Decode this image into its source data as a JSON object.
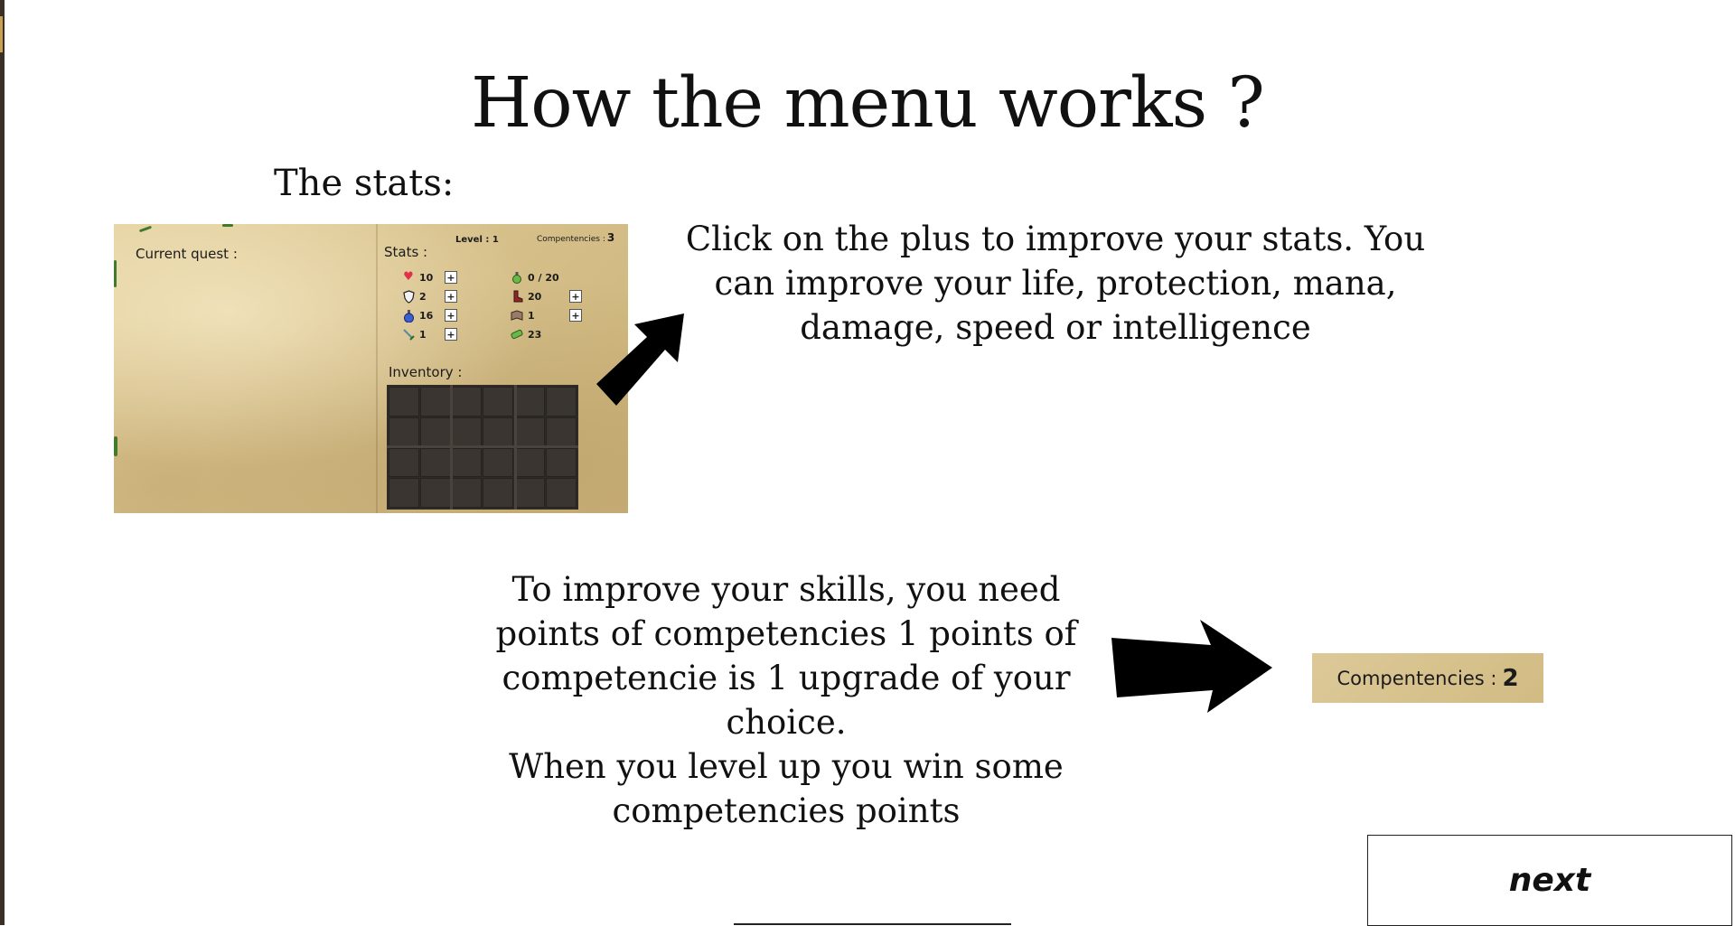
{
  "page": {
    "title": "How the menu works ?",
    "stats_heading": "The stats:",
    "description_stats": "Click on the plus to improve your stats. You can improve your life, protection, mana, damage, speed or intelligence",
    "description_competencies_1": "To improve your skills, you need points of competencies 1 points of competencie is 1 upgrade of your choice.",
    "description_competencies_2": "When you level up you win some competencies points",
    "next_label": "next"
  },
  "panel": {
    "current_quest_label": "Current quest :",
    "level_label": "Level : 1",
    "competencies_label": "Compentencies :",
    "competencies_value": "3",
    "stats_label": "Stats :",
    "inventory_label": "Inventory :",
    "plus_label": "+",
    "stats_left": [
      {
        "icon": "heart-icon",
        "value": "10"
      },
      {
        "icon": "shield-icon",
        "value": "2"
      },
      {
        "icon": "mana-potion-icon",
        "value": "16"
      },
      {
        "icon": "sword-icon",
        "value": "1"
      }
    ],
    "stats_right": [
      {
        "icon": "xp-flask-icon",
        "value": "0 / 20"
      },
      {
        "icon": "boot-icon",
        "value": "20"
      },
      {
        "icon": "book-icon",
        "value": "1"
      },
      {
        "icon": "gold-icon",
        "value": "23"
      }
    ]
  },
  "competencies_badge": {
    "label": "Compentencies :",
    "value": "2"
  },
  "colors": {
    "parchment": "#d8c28d",
    "inventory": "#2f2b27",
    "heart": "#e0304a",
    "mana": "#3a5fd0",
    "vine": "#3f7a2e"
  }
}
